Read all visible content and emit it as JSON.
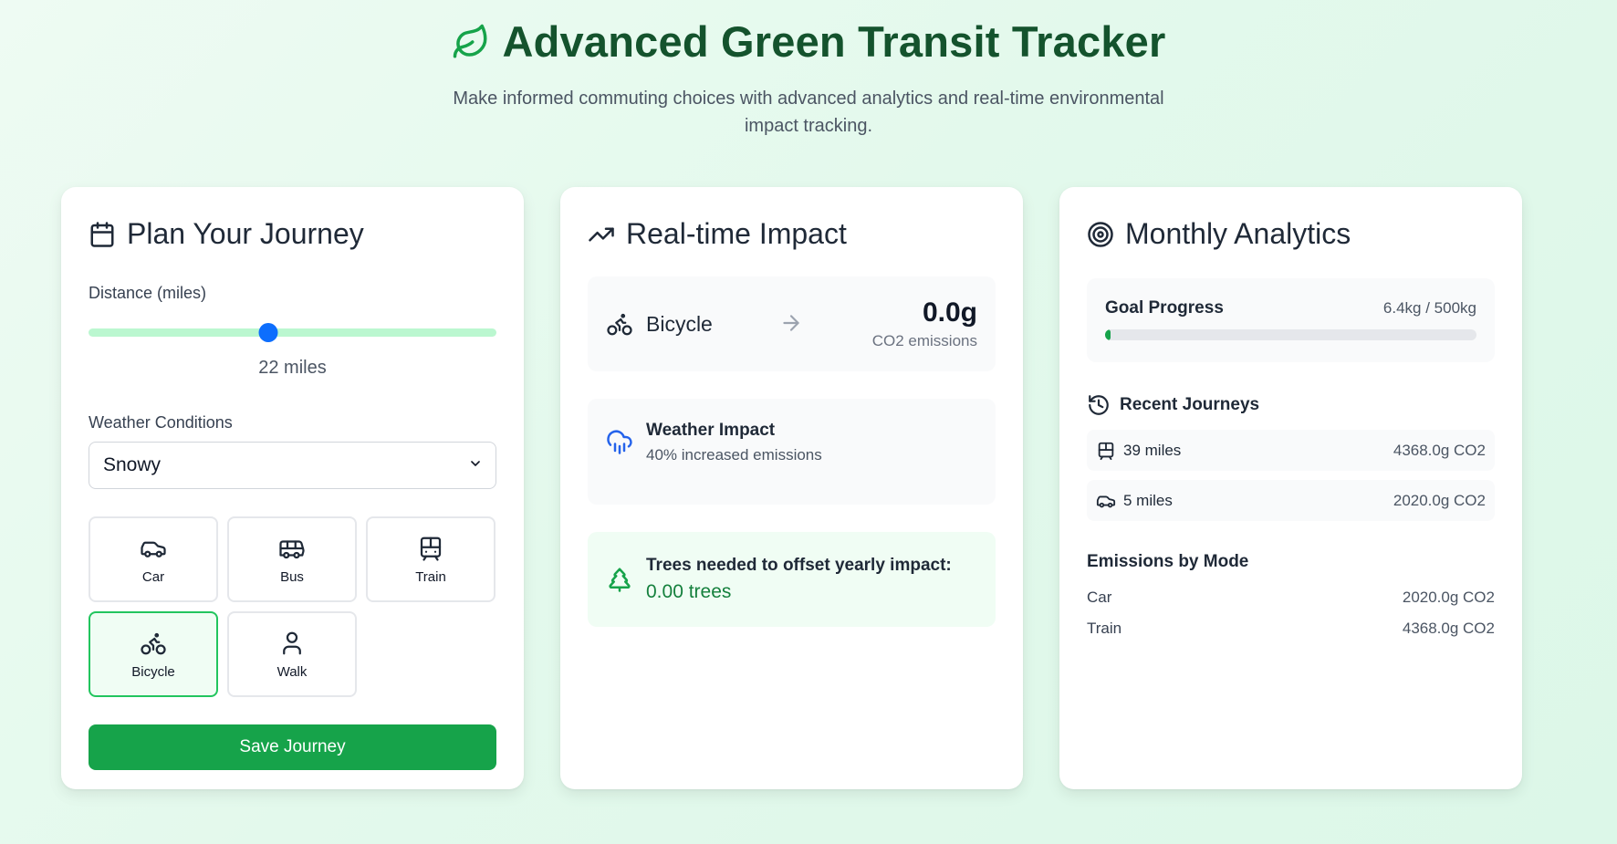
{
  "header": {
    "title": "Advanced Green Transit Tracker",
    "subtitle": "Make informed commuting choices with advanced analytics and real-time environmental impact tracking."
  },
  "plan": {
    "title": "Plan Your Journey",
    "distance_label": "Distance (miles)",
    "distance_value": 22,
    "distance_max": 50,
    "distance_text": "22 miles",
    "weather_label": "Weather Conditions",
    "weather_selected": "Snowy",
    "modes": [
      {
        "label": "Car",
        "icon": "car-icon"
      },
      {
        "label": "Bus",
        "icon": "bus-icon"
      },
      {
        "label": "Train",
        "icon": "train-icon"
      },
      {
        "label": "Bicycle",
        "icon": "bicycle-icon",
        "selected": true
      },
      {
        "label": "Walk",
        "icon": "walk-icon"
      }
    ],
    "save_label": "Save Journey"
  },
  "impact": {
    "title": "Real-time Impact",
    "mode": "Bicycle",
    "emission_value": "0.0g",
    "emission_label": "CO2 emissions",
    "weather_title": "Weather Impact",
    "weather_text": "40% increased emissions",
    "trees_title": "Trees needed to offset yearly impact:",
    "trees_value": "0.00 trees"
  },
  "analytics": {
    "title": "Monthly Analytics",
    "goal_title": "Goal Progress",
    "goal_value": "6.4kg / 500kg",
    "goal_fraction": 0.0128,
    "recent_title": "Recent Journeys",
    "journeys": [
      {
        "icon": "train-icon",
        "distance": "39 miles",
        "co2": "4368.0g CO2"
      },
      {
        "icon": "car-icon",
        "distance": "5 miles",
        "co2": "2020.0g CO2"
      }
    ],
    "by_mode_title": "Emissions by Mode",
    "by_mode": [
      {
        "mode": "Car",
        "value": "2020.0g CO2"
      },
      {
        "mode": "Train",
        "value": "4368.0g CO2"
      }
    ]
  },
  "colors": {
    "accent": "#16a34a",
    "title": "#14532d",
    "slider_thumb": "#0d6efd",
    "weather_icon": "#2563eb"
  }
}
